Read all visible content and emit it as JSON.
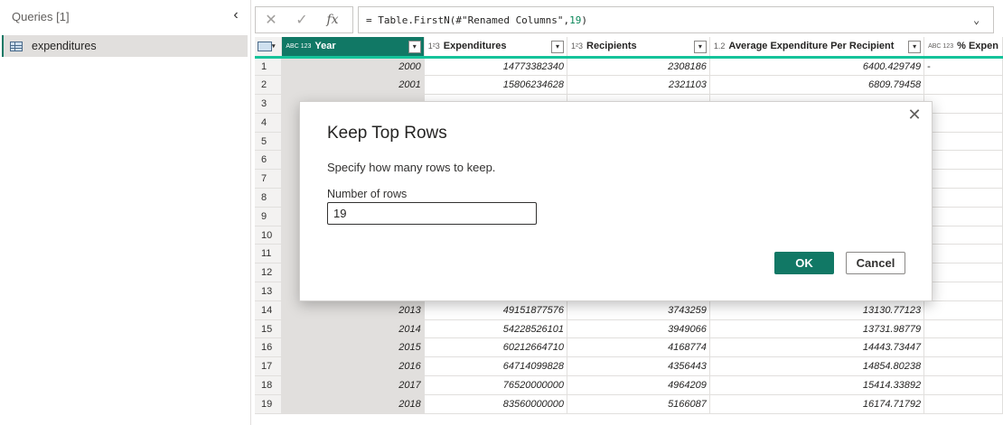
{
  "queries": {
    "header": "Queries [1]",
    "items": [
      {
        "label": "expenditures"
      }
    ]
  },
  "formula": {
    "prefix": "= Table.FirstN(#\"Renamed Columns\",",
    "number": "19",
    "suffix": ")"
  },
  "grid": {
    "columns": [
      {
        "type": "ABC\n123",
        "label": "Year"
      },
      {
        "type": "1²3",
        "label": "Expenditures"
      },
      {
        "type": "1²3",
        "label": "Recipients"
      },
      {
        "type": "1.2",
        "label": "Average Expenditure Per Recipient"
      },
      {
        "type": "ABC\n123",
        "label": "% Expen"
      }
    ],
    "rows": [
      [
        "1",
        "2000",
        "14773382340",
        "2308186",
        "6400.429749",
        "-"
      ],
      [
        "2",
        "2001",
        "15806234628",
        "2321103",
        "6809.79458",
        ""
      ],
      [
        "3",
        "",
        "",
        "",
        "",
        ""
      ],
      [
        "4",
        "",
        "",
        "",
        "",
        ""
      ],
      [
        "5",
        "",
        "",
        "",
        "",
        ""
      ],
      [
        "6",
        "",
        "",
        "",
        "",
        ""
      ],
      [
        "7",
        "",
        "",
        "",
        "",
        ""
      ],
      [
        "8",
        "",
        "",
        "",
        "",
        ""
      ],
      [
        "9",
        "",
        "",
        "",
        "",
        ""
      ],
      [
        "10",
        "",
        "",
        "",
        "",
        ""
      ],
      [
        "11",
        "",
        "",
        "",
        "",
        ""
      ],
      [
        "12",
        "",
        "",
        "",
        "",
        ""
      ],
      [
        "13",
        "",
        "",
        "",
        "",
        ""
      ],
      [
        "14",
        "2013",
        "49151877576",
        "3743259",
        "13130.77123",
        ""
      ],
      [
        "15",
        "2014",
        "54228526101",
        "3949066",
        "13731.98779",
        ""
      ],
      [
        "16",
        "2015",
        "60212664710",
        "4168774",
        "14443.73447",
        ""
      ],
      [
        "17",
        "2016",
        "64714099828",
        "4356443",
        "14854.80238",
        ""
      ],
      [
        "18",
        "2017",
        "76520000000",
        "4964209",
        "15414.33892",
        ""
      ],
      [
        "19",
        "2018",
        "83560000000",
        "5166087",
        "16174.71792",
        ""
      ]
    ]
  },
  "dialog": {
    "title": "Keep Top Rows",
    "description": "Specify how many rows to keep.",
    "field_label": "Number of rows",
    "field_value": "19",
    "ok_label": "OK",
    "cancel_label": "Cancel",
    "close_glyph": "✕"
  },
  "icons": {
    "cancel": "✕",
    "commit": "✓",
    "fx": "fx",
    "expand": "⌄",
    "collapse": "‹",
    "dropdown": "▾"
  },
  "colors": {
    "accent": "#117865",
    "column_quality": "#15c39a"
  }
}
